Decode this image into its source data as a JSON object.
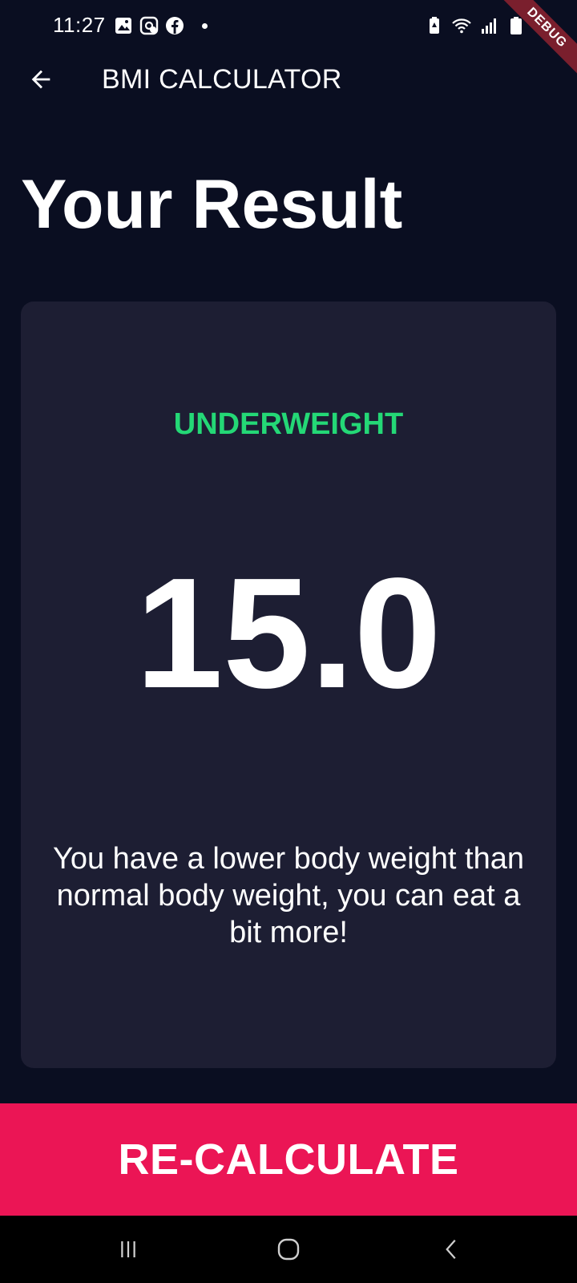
{
  "status_bar": {
    "time": "11:27",
    "left_icons": [
      "gallery-icon",
      "messenger-icon",
      "facebook-icon",
      "notification-dot-icon"
    ],
    "right_icons": [
      "battery-saver-icon",
      "wifi-icon",
      "signal-icon",
      "battery-icon"
    ]
  },
  "debug_banner": "DEBUG",
  "app_bar": {
    "title": "BMI CALCULATOR"
  },
  "page": {
    "heading": "Your Result"
  },
  "result": {
    "status": "UNDERWEIGHT",
    "bmi": "15.0",
    "message": "You have a lower body weight than normal body weight, you can eat a bit more!"
  },
  "bottom_button": {
    "label": "RE-CALCULATE"
  },
  "colors": {
    "background": "#0a0e21",
    "card": "#1d1e33",
    "status_green": "#24d876",
    "accent_pink": "#eb1555",
    "text": "#ffffff"
  }
}
